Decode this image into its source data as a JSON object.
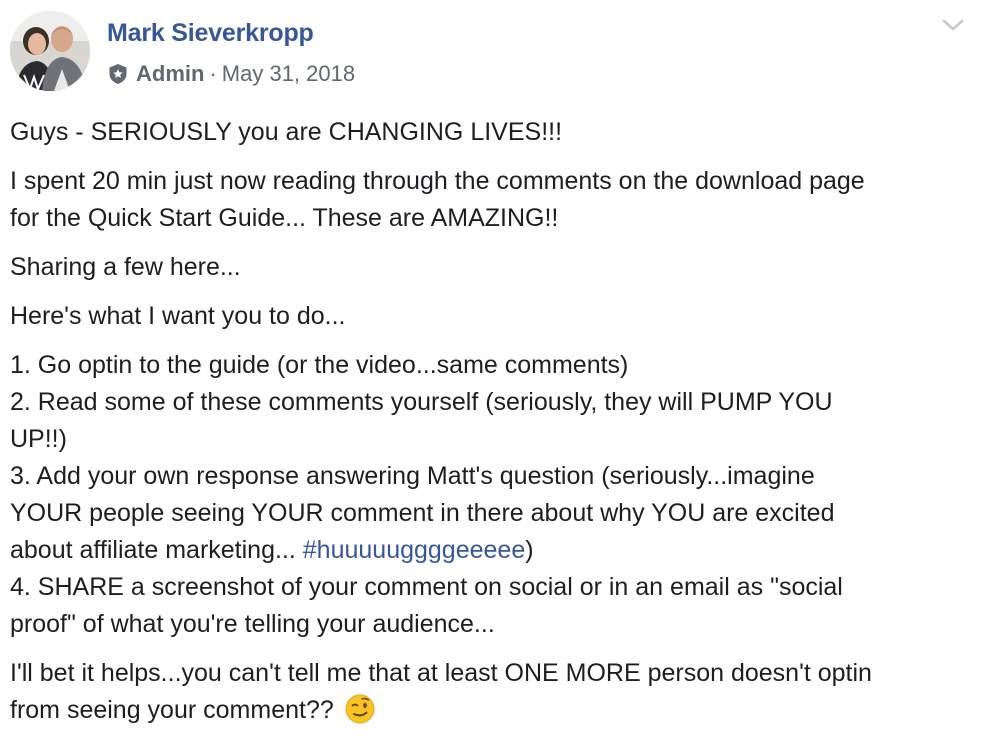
{
  "post": {
    "author": {
      "name": "Mark Sieverkropp",
      "role": "Admin",
      "separator": "·",
      "date": "May 31, 2018"
    },
    "menu_icon": "chevron-down-icon",
    "paragraphs": [
      {
        "lines": [
          {
            "text": "Guys - SERIOUSLY you are CHANGING LIVES!!!"
          }
        ]
      },
      {
        "lines": [
          {
            "text": "I spent 20 min just now reading through the comments on the download page"
          },
          {
            "text": "for the Quick Start Guide... These are AMAZING!!"
          }
        ]
      },
      {
        "lines": [
          {
            "text": "Sharing a few here..."
          }
        ]
      },
      {
        "lines": [
          {
            "text": "Here's what I want you to do..."
          }
        ]
      },
      {
        "lines": [
          {
            "text": "1. Go optin to the guide (or the video...same comments)"
          },
          {
            "text": "2. Read some of these comments yourself (seriously, they will PUMP YOU"
          },
          {
            "text": "UP!!)"
          },
          {
            "text": "3. Add your own response answering Matt's question (seriously...imagine"
          },
          {
            "text": "YOUR people seeing YOUR comment in there about why YOU are excited"
          },
          {
            "text": "about affiliate marketing... ",
            "hashtag": "#huuuuuggggeeeee",
            "after": ")"
          },
          {
            "text": "4. SHARE a screenshot of your comment on social or in an email as \"social"
          },
          {
            "text": "proof\" of what you're telling your audience..."
          }
        ]
      },
      {
        "lines": [
          {
            "text": "I'll bet it helps...you can't tell me that at least ONE MORE person doesn't optin"
          },
          {
            "text": "from seeing your comment?? ",
            "emoji": "winking-face-emoji"
          }
        ]
      }
    ]
  },
  "colors": {
    "link": "#365899",
    "meta": "#606770",
    "text": "#1c1e21",
    "emoji": "#f7c325"
  }
}
